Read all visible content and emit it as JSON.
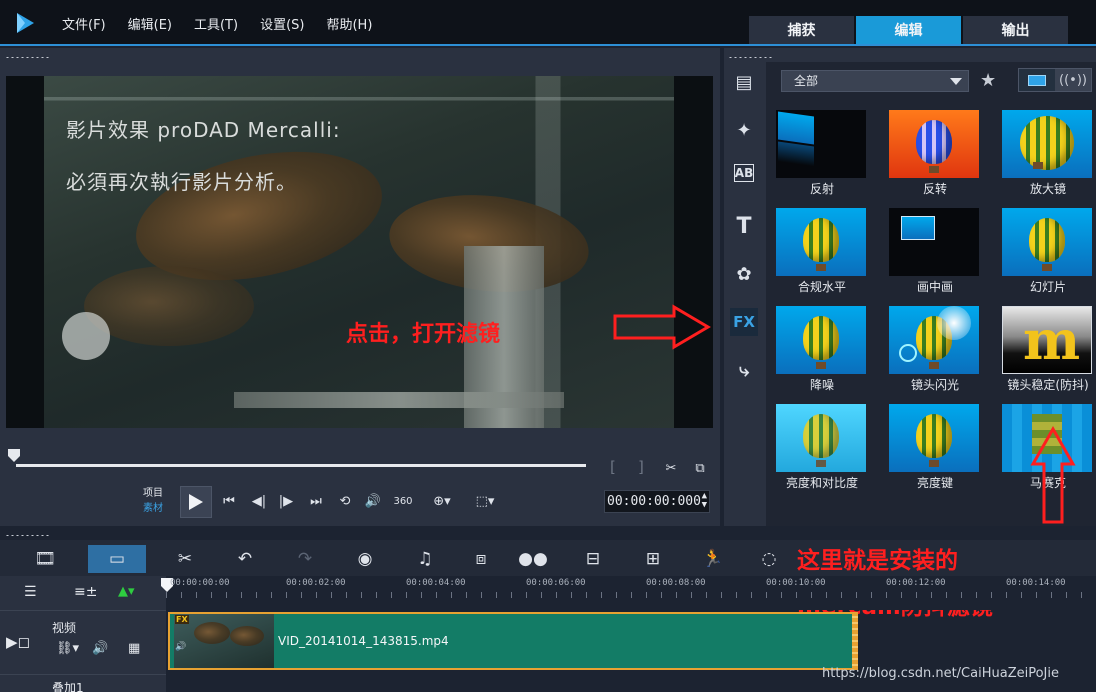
{
  "menu": {
    "items": [
      "文件(F)",
      "编辑(E)",
      "工具(T)",
      "设置(S)",
      "帮助(H)"
    ],
    "mode_tabs": [
      "捕获",
      "编辑",
      "输出"
    ],
    "active_mode": "编辑"
  },
  "preview": {
    "overlay_line1": "影片效果 proDAD Mercalli:",
    "overlay_line2": "必須再次執行影片分析。",
    "annotation_open_filter": "点击，打开滤镜",
    "mode_project": "项目",
    "mode_clip": "素材",
    "timecode": "00:00:00:000",
    "bracket_in": "[",
    "bracket_out": "]"
  },
  "library": {
    "category": "全部",
    "sidebar_fx_label": "FX",
    "filters": [
      {
        "label": "反射",
        "icon": "reflection-thumb"
      },
      {
        "label": "反转",
        "icon": "invert-thumb"
      },
      {
        "label": "放大镜",
        "icon": "magnifier-thumb"
      },
      {
        "label": "合规水平",
        "icon": "balloon-thumb"
      },
      {
        "label": "画中画",
        "icon": "pip-thumb"
      },
      {
        "label": "幻灯片",
        "icon": "balloon-thumb"
      },
      {
        "label": "降噪",
        "icon": "balloon-thumb"
      },
      {
        "label": "镜头闪光",
        "icon": "lens-flare-thumb"
      },
      {
        "label": "镜头稳定(防抖)",
        "icon": "mercalli-thumb"
      },
      {
        "label": "亮度和对比度",
        "icon": "balloon-thumb"
      },
      {
        "label": "亮度键",
        "icon": "balloon-thumb"
      },
      {
        "label": "马赛克",
        "icon": "mosaic-thumb"
      }
    ]
  },
  "annotations": {
    "installed_line1": "这里就是安装的",
    "installed_line2": "mercalli防抖滤镜"
  },
  "timeline": {
    "ticks": [
      "00:00:00:00",
      "00:00:02:00",
      "00:00:04:00",
      "00:00:06:00",
      "00:00:08:00",
      "00:00:10:00",
      "00:00:12:00",
      "00:00:14:00"
    ],
    "track_video": "视频",
    "track_overlay": "叠加1",
    "clip_name": "VID_20141014_143815.mp4",
    "clip_fx_badge": "FX"
  },
  "watermark": "https://blog.csdn.net/CaiHuaZeiPoJie",
  "colors": {
    "accent": "#1a9ad8",
    "annotation_red": "#ff1f1f",
    "clip_green": "#137c66"
  }
}
